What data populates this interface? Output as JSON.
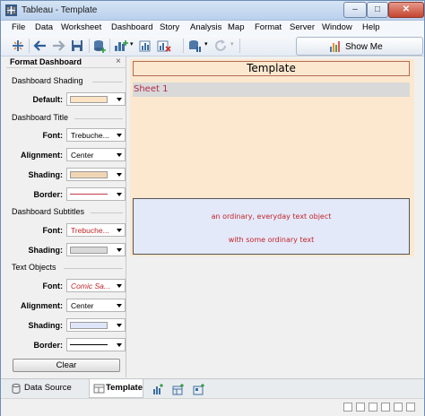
{
  "window": {
    "title": "Tableau - Template",
    "buttons": {
      "minimize": "–",
      "maximize": "□",
      "close": "✕"
    }
  },
  "menu": {
    "items": [
      "File",
      "Data",
      "Worksheet",
      "Dashboard",
      "Story",
      "Analysis",
      "Map",
      "Format",
      "Server",
      "Window",
      "Help"
    ]
  },
  "toolbar": {
    "show_me_label": "Show Me"
  },
  "format_panel": {
    "title": "Format Dashboard",
    "close": "×",
    "sections": {
      "shading": {
        "heading": "Dashboard Shading",
        "default_label": "Default:",
        "default_color": "#fbe3c4"
      },
      "title": {
        "heading": "Dashboard Title",
        "font_label": "Font:",
        "font_value": "Trebuche...",
        "alignment_label": "Alignment:",
        "alignment_value": "Center",
        "shading_label": "Shading:",
        "shading_color": "#f2d6b4",
        "border_label": "Border:",
        "border_color": "#c0394a"
      },
      "subtitles": {
        "heading": "Dashboard Subtitles",
        "font_label": "Font:",
        "font_value": "Trebuche...",
        "font_color": "#c0252a",
        "shading_label": "Shading:",
        "shading_color": "#d9d9d9"
      },
      "text_objects": {
        "heading": "Text Objects",
        "font_label": "Font:",
        "font_value": "Comic Sa...",
        "font_color": "#c0252a",
        "alignment_label": "Alignment:",
        "alignment_value": "Center",
        "shading_label": "Shading:",
        "shading_color": "#e0e6fa",
        "border_label": "Border:",
        "border_color": "#000000"
      }
    },
    "clear_label": "Clear"
  },
  "dashboard": {
    "title": "Template",
    "sheet_title": "Sheet 1",
    "text_line1": "an ordinary, everyday text object",
    "text_line2": "with some ordinary text",
    "background": "#fbe8cf"
  },
  "tabs": {
    "data_source": "Data Source",
    "active": "Template"
  }
}
